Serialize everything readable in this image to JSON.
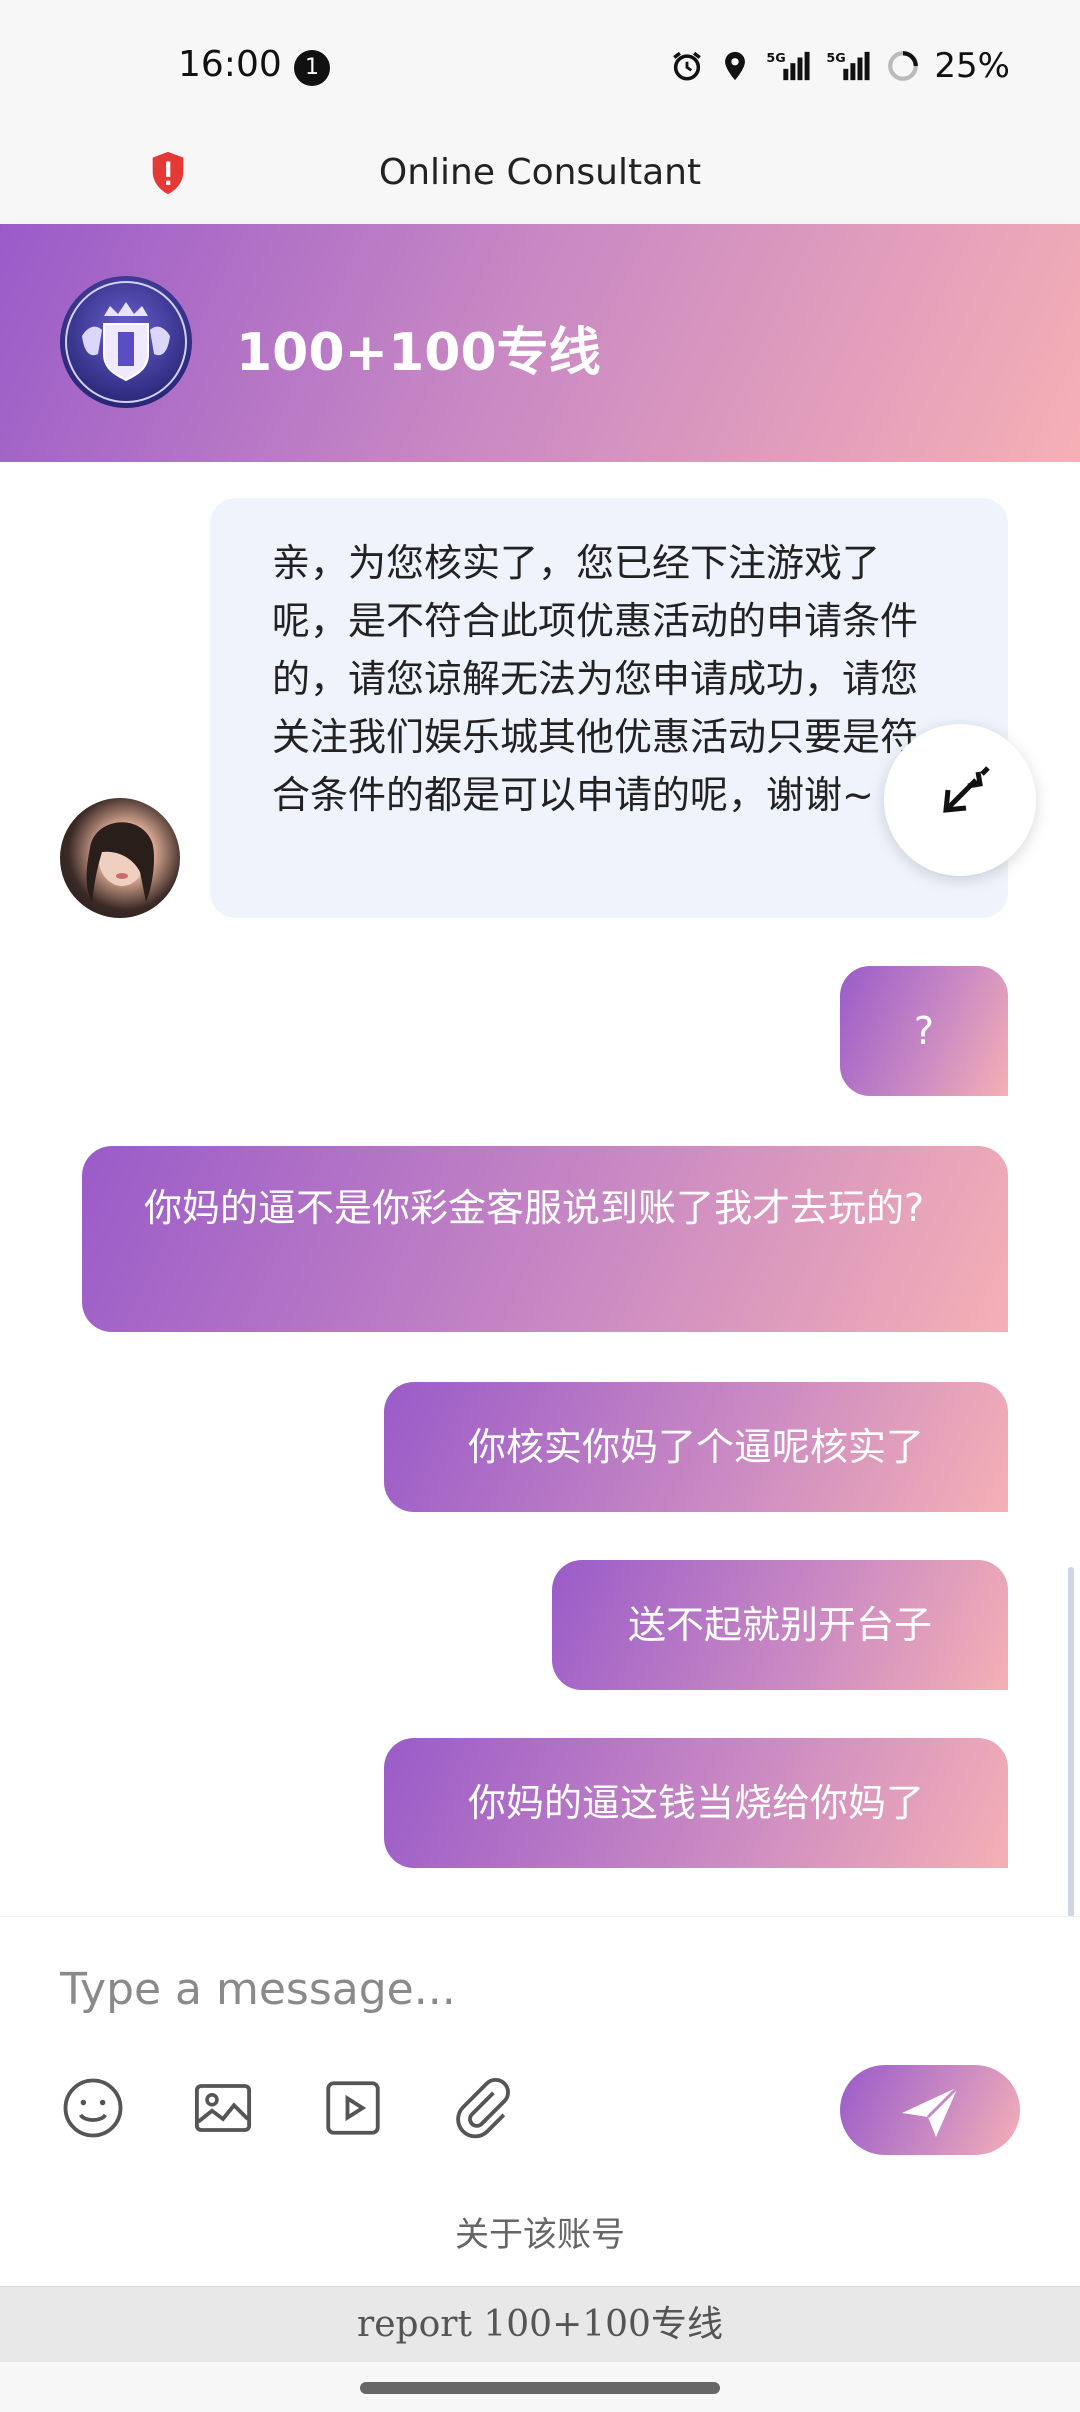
{
  "status_bar": {
    "time": "16:00",
    "notification_count": "1",
    "battery": "25%",
    "icons": [
      "alarm-icon",
      "location-icon",
      "signal-5g-icon",
      "signal-5g-icon",
      "battery-ring-icon"
    ]
  },
  "titlebar": {
    "title": "Online Consultant",
    "security_icon": "shield-alert-icon"
  },
  "header": {
    "name": "100+100专线",
    "logo_icon": "crest-logo-icon"
  },
  "messages": [
    {
      "from": "agent",
      "text": "亲，为您核实了，您已经下注游戏了呢，是不符合此项优惠活动的申请条件的，请您谅解无法为您申请成功，请您关注我们娱乐城其他优惠活动只要是符合条件的都是可以申请的呢，谢谢~"
    },
    {
      "from": "user",
      "text": "?"
    },
    {
      "from": "user",
      "text": "你妈的逼不是你彩金客服说到账了我才去玩的?"
    },
    {
      "from": "user",
      "text": "你核实你妈了个逼呢核实了"
    },
    {
      "from": "user",
      "text": "送不起就别开台子"
    },
    {
      "from": "user",
      "text": "你妈的逼这钱当烧给你妈了"
    }
  ],
  "input": {
    "placeholder": "Type a message...",
    "value": ""
  },
  "toolbar": {
    "emoji": "emoji-icon",
    "image": "image-icon",
    "video": "video-icon",
    "attach": "paperclip-icon",
    "send": "send-icon"
  },
  "about_label": "关于该账号",
  "report_label": "report 100+100专线",
  "colors": {
    "gradient_start": "#9a5bc9",
    "gradient_end": "#f6b0b5",
    "agent_bubble": "#eef3fc"
  }
}
